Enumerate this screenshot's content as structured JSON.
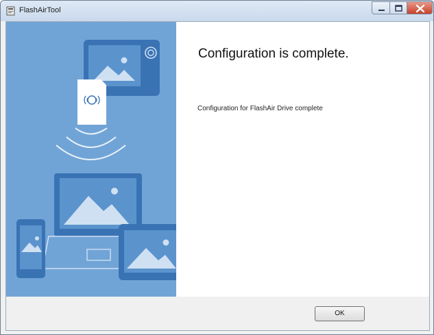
{
  "window": {
    "title": "FlashAirTool",
    "icon": "app-icon"
  },
  "controls": {
    "minimize": "minimize-icon",
    "maximize": "maximize-icon",
    "close": "close-icon"
  },
  "main": {
    "heading": "Configuration is complete.",
    "message": "Configuration for FlashAir Drive complete"
  },
  "footer": {
    "ok_label": "OK"
  },
  "colors": {
    "side_panel": "#71a4d6",
    "illustration_dark": "#3a73b4",
    "illustration_light": "#cfe0f2"
  }
}
